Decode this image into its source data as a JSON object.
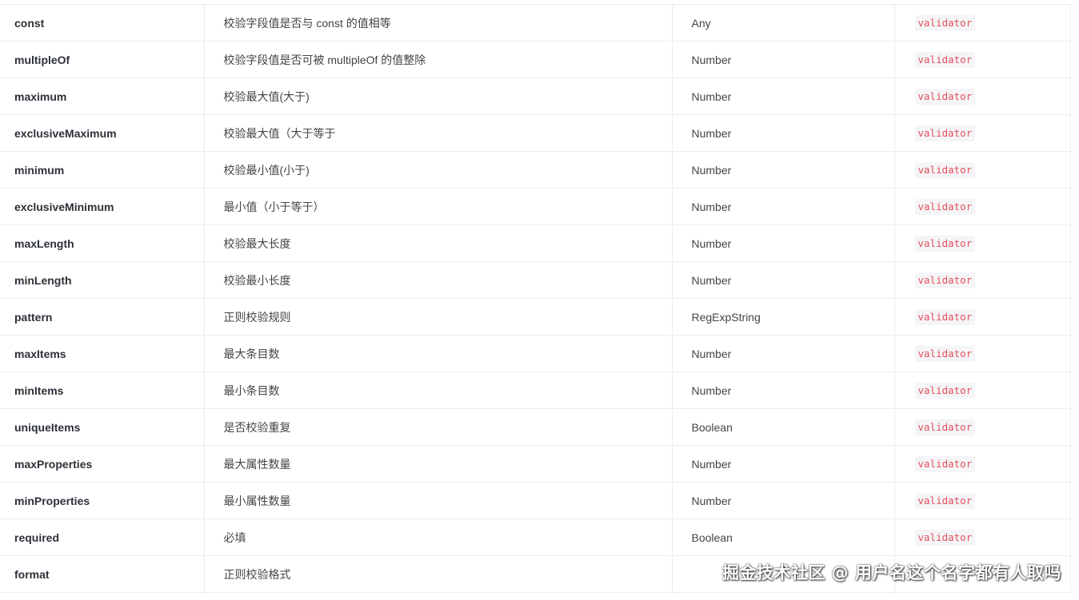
{
  "table": {
    "rows": [
      {
        "name": "const",
        "description": "校验字段值是否与 const 的值相等",
        "type": "Any",
        "tag": "validator"
      },
      {
        "name": "multipleOf",
        "description": "校验字段值是否可被 multipleOf 的值整除",
        "type": "Number",
        "tag": "validator"
      },
      {
        "name": "maximum",
        "description": "校验最大值(大于)",
        "type": "Number",
        "tag": "validator"
      },
      {
        "name": "exclusiveMaximum",
        "description": "校验最大值（大于等于",
        "type": "Number",
        "tag": "validator"
      },
      {
        "name": "minimum",
        "description": "校验最小值(小于)",
        "type": "Number",
        "tag": "validator"
      },
      {
        "name": "exclusiveMinimum",
        "description": "最小值（小于等于）",
        "type": "Number",
        "tag": "validator"
      },
      {
        "name": "maxLength",
        "description": "校验最大长度",
        "type": "Number",
        "tag": "validator"
      },
      {
        "name": "minLength",
        "description": "校验最小长度",
        "type": "Number",
        "tag": "validator"
      },
      {
        "name": "pattern",
        "description": "正则校验规则",
        "type": "RegExpString",
        "tag": "validator"
      },
      {
        "name": "maxItems",
        "description": "最大条目数",
        "type": "Number",
        "tag": "validator"
      },
      {
        "name": "minItems",
        "description": "最小条目数",
        "type": "Number",
        "tag": "validator"
      },
      {
        "name": "uniqueItems",
        "description": "是否校验重复",
        "type": "Boolean",
        "tag": "validator"
      },
      {
        "name": "maxProperties",
        "description": "最大属性数量",
        "type": "Number",
        "tag": "validator"
      },
      {
        "name": "minProperties",
        "description": "最小属性数量",
        "type": "Number",
        "tag": "validator"
      },
      {
        "name": "required",
        "description": "必填",
        "type": "Boolean",
        "tag": "validator"
      },
      {
        "name": "format",
        "description": "正则校验格式",
        "type": "",
        "tag": ""
      }
    ]
  },
  "watermark": "掘金技术社区 @ 用户名这个名字都有人取吗",
  "colors": {
    "code_text": "#e34f5b",
    "code_bg": "#f5f5f7",
    "border": "#ececec"
  }
}
